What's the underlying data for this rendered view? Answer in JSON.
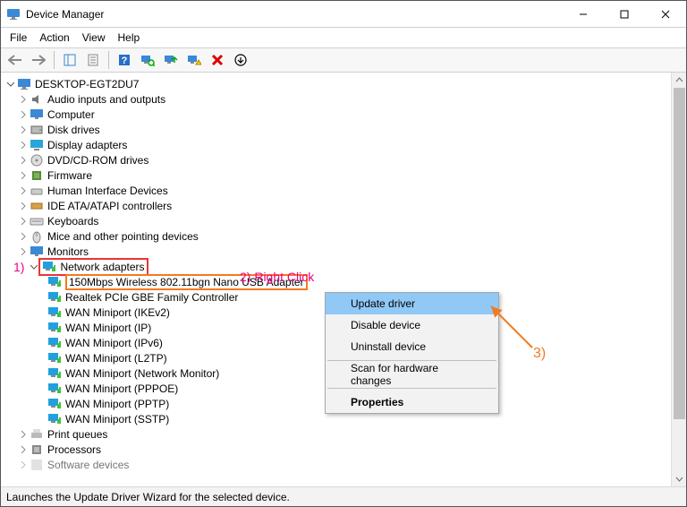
{
  "window": {
    "title": "Device Manager"
  },
  "menu": {
    "file": "File",
    "action": "Action",
    "view": "View",
    "help": "Help"
  },
  "root": "DESKTOP-EGT2DU7",
  "cats": {
    "audio": "Audio inputs and outputs",
    "computer": "Computer",
    "disk": "Disk drives",
    "display": "Display adapters",
    "dvd": "DVD/CD-ROM drives",
    "firmware": "Firmware",
    "hid": "Human Interface Devices",
    "ide": "IDE ATA/ATAPI controllers",
    "keyboards": "Keyboards",
    "mice": "Mice and other pointing devices",
    "monitors": "Monitors",
    "network": "Network adapters",
    "printq": "Print queues",
    "processors": "Processors",
    "software": "Software devices"
  },
  "net": {
    "sel": "150Mbps Wireless 802.11bgn Nano USB Adapter",
    "realtek": "Realtek PCIe GBE Family Controller",
    "wanIkev2": "WAN Miniport (IKEv2)",
    "wanIp": "WAN Miniport (IP)",
    "wanIpv6": "WAN Miniport (IPv6)",
    "wanL2tp": "WAN Miniport (L2TP)",
    "wanNetmon": "WAN Miniport (Network Monitor)",
    "wanPppoe": "WAN Miniport (PPPOE)",
    "wanPptp": "WAN Miniport (PPTP)",
    "wanSstp": "WAN Miniport (SSTP)"
  },
  "ctx": {
    "update": "Update driver",
    "disable": "Disable device",
    "uninstall": "Uninstall device",
    "scan": "Scan for hardware changes",
    "props": "Properties"
  },
  "annot": {
    "one": "1)",
    "two": "2) Right Click",
    "three": "3)"
  },
  "status": "Launches the Update Driver Wizard for the selected device."
}
